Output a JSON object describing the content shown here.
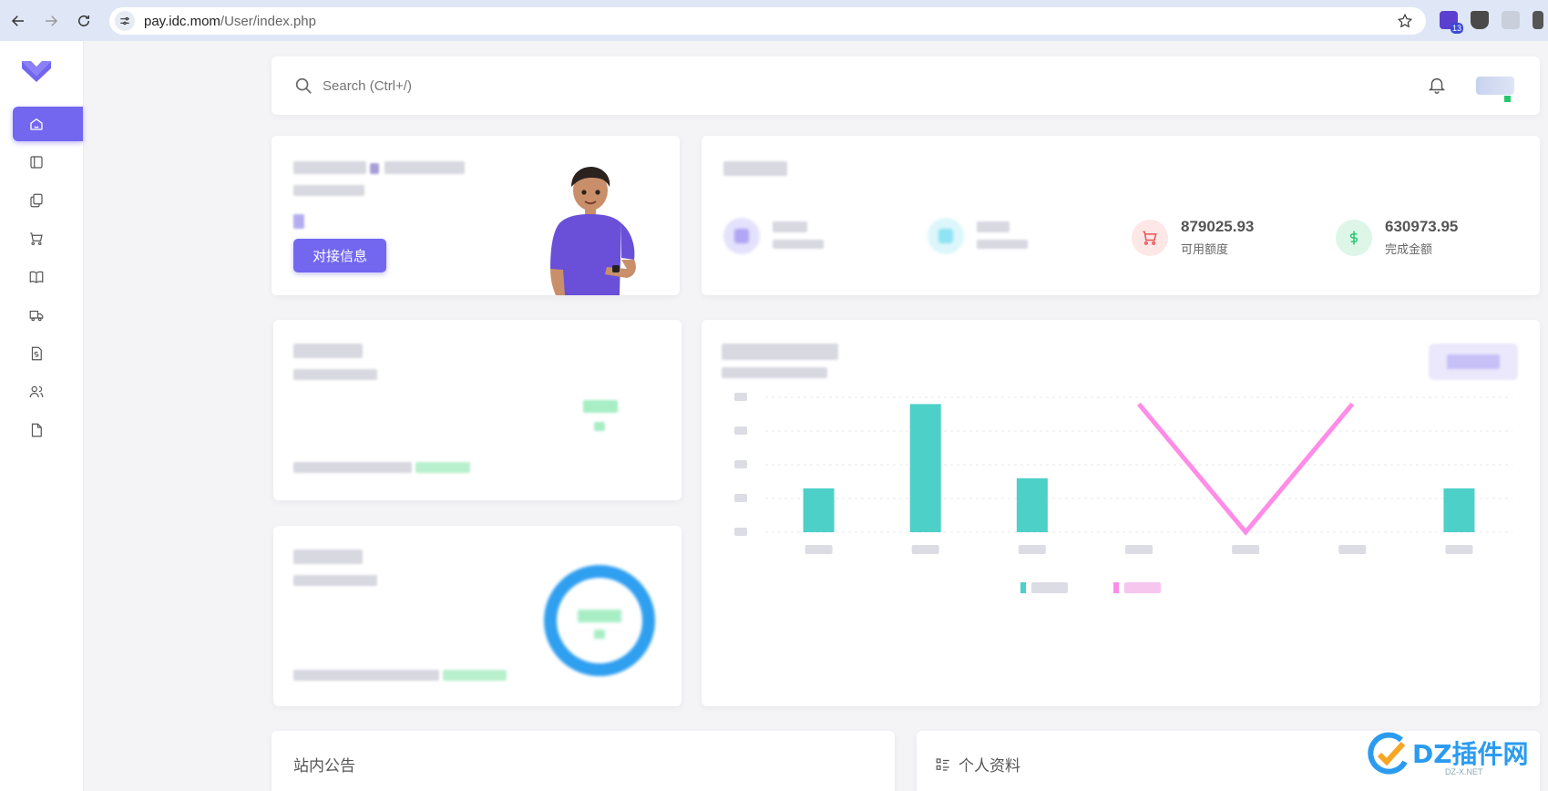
{
  "browser": {
    "url_host": "pay.idc.mom",
    "url_path": "/User/index.php",
    "extension_badge": "13"
  },
  "sidebar": {
    "items": [
      {
        "icon": "home-icon",
        "active": true
      },
      {
        "icon": "layout-icon"
      },
      {
        "icon": "files-icon"
      },
      {
        "icon": "cart-icon"
      },
      {
        "icon": "book-icon"
      },
      {
        "icon": "truck-icon"
      },
      {
        "icon": "invoice-icon"
      },
      {
        "icon": "users-icon"
      },
      {
        "icon": "file-icon"
      }
    ]
  },
  "topbar": {
    "search_placeholder": "Search (Ctrl+/)"
  },
  "welcome": {
    "button_label": "对接信息"
  },
  "stats": {
    "items": [
      {
        "value": "879025.93",
        "label": "可用额度",
        "color": "#ea5455",
        "icon": "cart-icon"
      },
      {
        "value": "630973.95",
        "label": "完成金额",
        "color": "#28c76f",
        "icon": "dollar-icon"
      }
    ]
  },
  "chart_data": {
    "type": "bar",
    "categories": [
      "",
      "",
      "",
      "",
      "",
      "",
      ""
    ],
    "series": [
      {
        "values": [
          26,
          76,
          32,
          0,
          0,
          0,
          26
        ],
        "color": "#4dd0c8"
      },
      {
        "values": [
          0,
          0,
          0,
          76,
          0,
          76,
          0
        ],
        "color": "#ff8ce6"
      }
    ],
    "ylim": [
      0,
      80
    ]
  },
  "bottom": {
    "notice_title": "站内公告",
    "profile_title": "个人资料"
  },
  "watermark": {
    "text": "DZ插件网",
    "sub": "DZ-X.NET"
  },
  "colors": {
    "primary": "#7367f0",
    "teal": "#4dd0c8",
    "pink": "#ff8ce6",
    "blue_ring": "#2f9ff0"
  }
}
